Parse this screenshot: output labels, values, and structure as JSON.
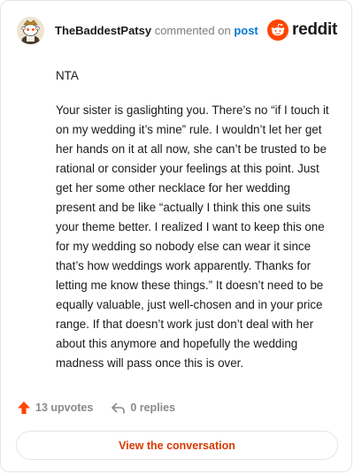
{
  "header": {
    "username": "TheBaddestPatsy",
    "action": " commented on ",
    "target": "post",
    "brand": "reddit",
    "avatar_icon": "snoo-avatar-icon",
    "brand_icon": "reddit-logo-icon"
  },
  "comment": {
    "paragraphs": [
      "NTA",
      "Your sister is gaslighting you. There’s no “if I touch it on my wedding it’s mine” rule. I wouldn’t let her get her hands on it at all now, she can’t be trusted to be rational or consider your feelings at this point. Just get her some other necklace for her wedding present and be like “actually I think this one suits your theme better. I realized I want to keep this one for my wedding so nobody else can wear it since that’s how weddings work apparently. Thanks for letting me know these things.” It doesn’t need to be equally valuable, just well-chosen and in your price range. If that doesn’t work just don’t deal with her about this anymore and hopefully the wedding madness will pass once this is over."
    ]
  },
  "footer": {
    "upvotes_label": "13 upvotes",
    "replies_label": "0 replies",
    "upvote_icon": "upvote-arrow-icon",
    "reply_icon": "reply-arrow-icon"
  },
  "view_button": {
    "label": "View the conversation"
  },
  "colors": {
    "reddit_orange": "#ff4500",
    "link_blue": "#0079d3",
    "button_text": "#d93900",
    "muted": "#878a8c"
  }
}
